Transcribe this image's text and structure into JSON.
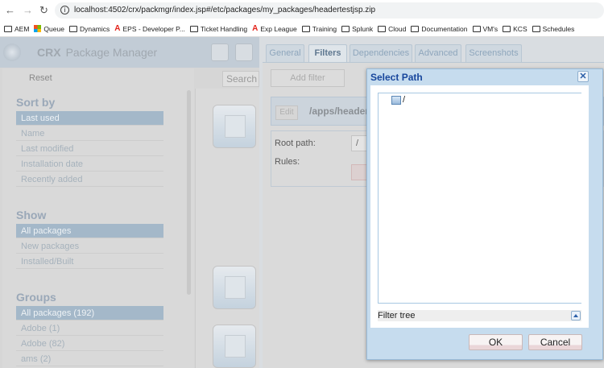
{
  "browser": {
    "url": "localhost:4502/crx/packmgr/index.jsp#/etc/packages/my_packages/headertestjsp.zip",
    "bookmarks": [
      {
        "label": "AEM",
        "icon": "folder-icon"
      },
      {
        "label": "Queue",
        "icon": "microsoft-icon"
      },
      {
        "label": "Dynamics",
        "icon": "folder-icon"
      },
      {
        "label": "EPS - Developer P...",
        "icon": "adobe-icon"
      },
      {
        "label": "Ticket Handling",
        "icon": "folder-icon"
      },
      {
        "label": "Exp League",
        "icon": "adobe-icon"
      },
      {
        "label": "Training",
        "icon": "folder-icon"
      },
      {
        "label": "Splunk",
        "icon": "folder-icon"
      },
      {
        "label": "Cloud",
        "icon": "folder-icon"
      },
      {
        "label": "Documentation",
        "icon": "folder-icon"
      },
      {
        "label": "VM's",
        "icon": "folder-icon"
      },
      {
        "label": "KCS",
        "icon": "folder-icon"
      },
      {
        "label": "Schedules",
        "icon": "folder-icon"
      }
    ]
  },
  "app": {
    "brand": "CRX",
    "title": "Package Manager",
    "reset": "Reset",
    "search_placeholder": "Search p"
  },
  "sidebar": {
    "sort_title": "Sort by",
    "sort": [
      "Last used",
      "Name",
      "Last modified",
      "Installation date",
      "Recently added"
    ],
    "show_title": "Show",
    "show": [
      "All packages",
      "New packages",
      "Installed/Built"
    ],
    "groups_title": "Groups",
    "groups": [
      "All packages (192)",
      "Adobe (1)",
      "Adobe (82)",
      "ams (2)"
    ]
  },
  "tabs": [
    "General",
    "Filters",
    "Dependencies",
    "Advanced",
    "Screenshots"
  ],
  "filters": {
    "add_filter": "Add filter",
    "edit": "Edit",
    "filter_path": "/apps/header",
    "root_path_label": "Root path:",
    "root_path_value": "/",
    "rules_label": "Rules:"
  },
  "dialog": {
    "title": "Select Path",
    "close": "✕",
    "tree_root": "/",
    "filter_tree": "Filter tree",
    "ok": "OK",
    "cancel": "Cancel"
  }
}
